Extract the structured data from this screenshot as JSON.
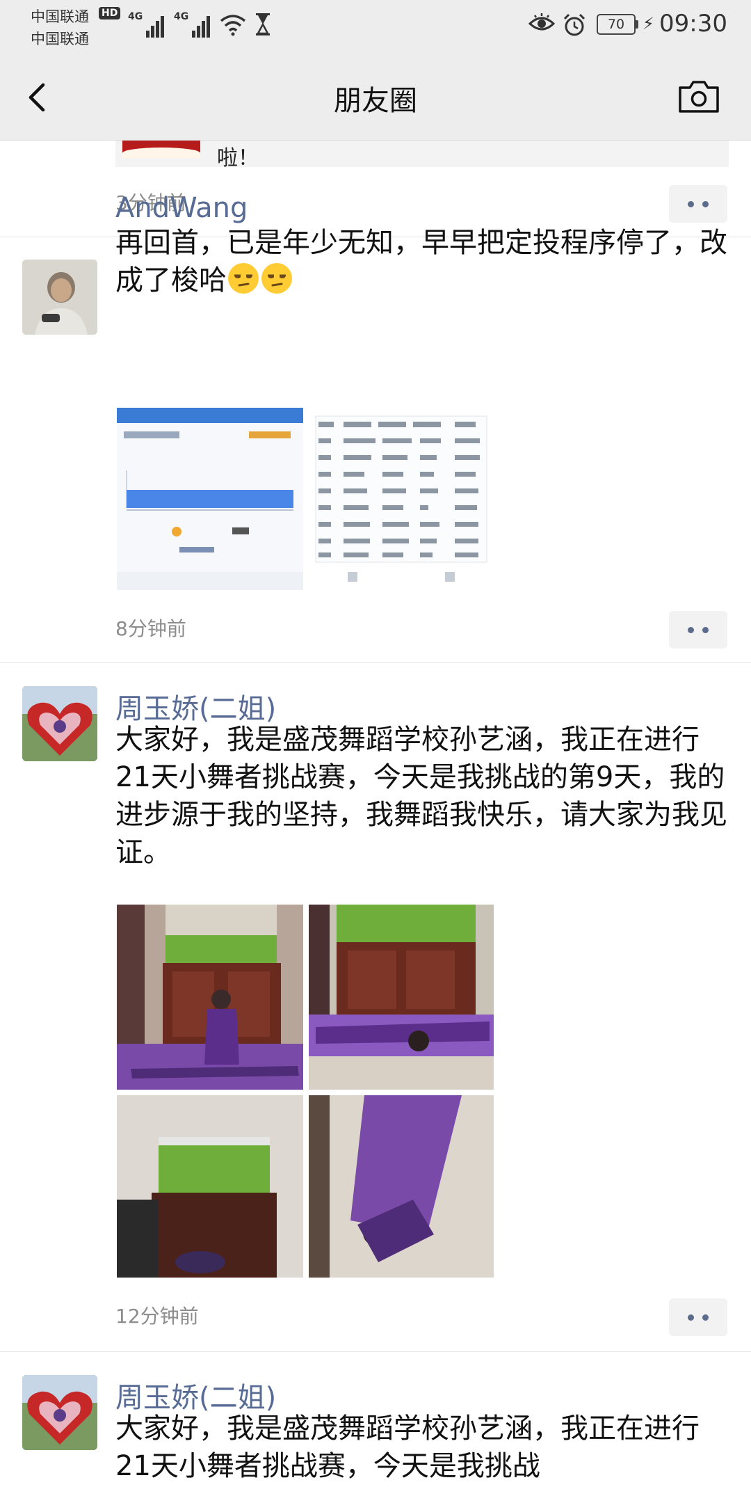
{
  "status_bar": {
    "carrier_1": "中国联通",
    "carrier_2": "中国联通",
    "hd_badge": "HD",
    "signal_label": "4G",
    "battery": "70",
    "time": "09:30"
  },
  "nav": {
    "title": "朋友圈",
    "back_icon": "chevron-left-icon",
    "camera_icon": "camera-icon"
  },
  "feed": {
    "prev_post": {
      "text_fragment": "啦！",
      "time": "3分钟前"
    },
    "posts": [
      {
        "author": "AndWang",
        "content": "再回首，已是年少无知，早早把定投程序停了，改成了梭哈",
        "time": "8分钟前"
      },
      {
        "author": "周玉娇(二姐)",
        "content": "大家好，我是盛茂舞蹈学校孙艺涵，我正在进行21天小舞者挑战赛，今天是我挑战的第9天，我的进步源于我的坚持，我舞蹈我快乐，请大家为我见证。",
        "time": "12分钟前"
      },
      {
        "author": "周玉娇(二姐)",
        "content": "大家好，我是盛茂舞蹈学校孙艺涵，我正在进行21天小舞者挑战赛，今天是我挑战"
      }
    ]
  },
  "colors": {
    "bar_bg": "#ededed",
    "author_blue": "#576b95",
    "time_gray": "#8c8c8c"
  }
}
